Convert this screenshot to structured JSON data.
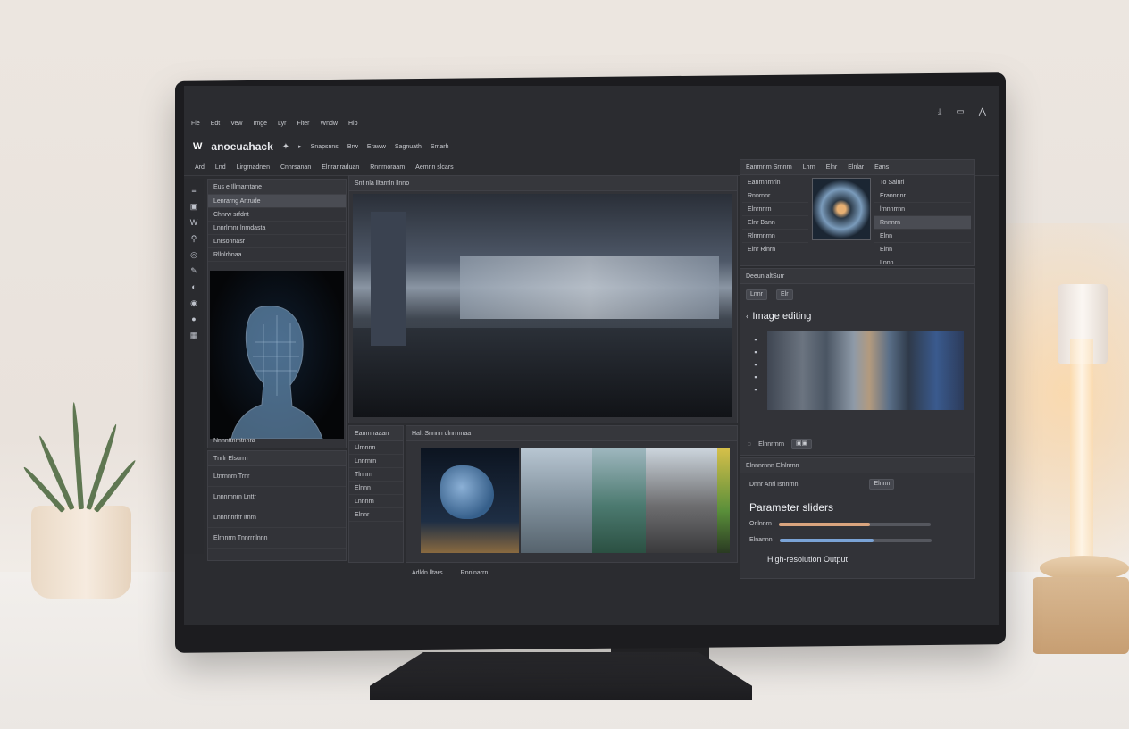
{
  "app": {
    "name": "anoeuahack",
    "menu": [
      "Fle",
      "Edt",
      "Vew",
      "Imge",
      "Lyr",
      "Flter",
      "Wndw",
      "Hlp"
    ],
    "title_items": [
      "Snapsnns",
      "Brw",
      "Eraww",
      "Sagnuath",
      "Smarh"
    ],
    "toolbar": [
      "Ard",
      "Lnd",
      "Lirgrnadnen",
      "Cnnrsanan",
      "Elnranraduan",
      "Rnnrnoraam",
      "Aemnn  slcars"
    ]
  },
  "left_panel": {
    "title": "Eus  e Illmamtane",
    "selected": "Lenrarng Artrude",
    "rows": [
      "Chnrw  srfdnt",
      "Lnnrlrnnr lnmdasta",
      "Lnrsonnasr",
      "Rllnlrhnaa"
    ],
    "caption": "Nnnnttnrntnnra"
  },
  "left_bottom_panel": {
    "title": "Tnrlr Elsurrn",
    "rows": [
      "Ltnrnnrn  Trnr",
      "Lnnnrnnrn  Lnttr",
      "Lnnnnnrlrr  Itnrn",
      "Elrnnrrn Tnnrrnlnnn"
    ]
  },
  "center_viewer": {
    "title": "Snt  nla  lltarnln  llnno"
  },
  "assets_panel": {
    "title": "Eanrnnaaan",
    "rows": [
      "Llrnnnn",
      "Lnnrnrn",
      "Tlnnrn",
      "Elnnn",
      "Lnnnrn",
      "Elnnr"
    ]
  },
  "filmstrip": {
    "title": "Halt Snnnn  dlnrrnnaa",
    "footer_left": "Adldn  lltars",
    "footer_right": "Rnnlnarrn"
  },
  "right_top": {
    "tabs": [
      "Eanrnnrn  Srnnrn",
      "Lhrn",
      "Elnr",
      "Elnlar",
      "Eans"
    ],
    "items": [
      "Eanrnnrnrln",
      "Rnnrnnr",
      "Elnrnnrn",
      "Elnr  Bann",
      "Rlnrnnrnn",
      "Elnr Rlnrn"
    ],
    "props": [
      "To  Salnrl",
      "Erannnnr",
      "lrnnnrrnn",
      "Rnnnrn",
      "Elnn",
      "Elnn",
      "Lnnn"
    ]
  },
  "right_mid": {
    "title": "Deeun  altSurr",
    "dropdown": "Lnnr",
    "search": "Elr",
    "heading": "Image editing",
    "footer": "Elnnrrnrn"
  },
  "right_bottom": {
    "title": "Elnnnrnnn  Elnlnrnn",
    "sub": "Dnnr  Anrl  Isnnrnn",
    "button": "Elnnn",
    "heading": "Parameter sliders",
    "sliders": [
      {
        "label": "Orllnnrn",
        "value": 0.6,
        "color": "#d9a47e"
      },
      {
        "label": "Elnannn",
        "value": 0.62,
        "color": "#7aa3d6"
      }
    ],
    "output_label": "High-resolution Output"
  }
}
